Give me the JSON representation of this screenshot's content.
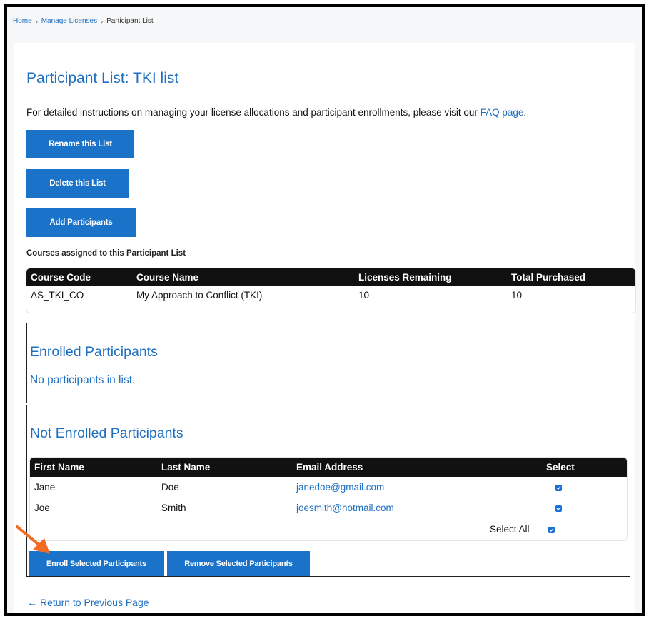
{
  "breadcrumb": {
    "home": "Home",
    "manage": "Manage Licenses",
    "current": "Participant List",
    "separator": "›"
  },
  "page": {
    "title": "Participant List: TKI list",
    "intro_text": "For detailed instructions on managing your license allocations and participant enrollments, please visit our ",
    "intro_link": "FAQ page",
    "intro_end": "."
  },
  "actions": {
    "rename": "Rename this List",
    "delete": "Delete this List",
    "add": "Add Participants"
  },
  "courses": {
    "label": "Courses assigned to this Participant List",
    "headers": [
      "Course Code",
      "Course Name",
      "Licenses Remaining",
      "Total Purchased"
    ],
    "rows": [
      [
        "AS_TKI_CO",
        "My Approach to Conflict (TKI)",
        "10",
        "10"
      ]
    ]
  },
  "enrolled": {
    "title": "Enrolled Participants",
    "empty": "No participants in list."
  },
  "not_enrolled": {
    "title": "Not Enrolled Participants",
    "headers": [
      "First Name",
      "Last Name",
      "Email Address",
      "Select"
    ],
    "rows": [
      {
        "first": "Jane",
        "last": "Doe",
        "email": "janedoe@gmail.com",
        "selected": true
      },
      {
        "first": "Joe",
        "last": "Smith",
        "email": "joesmith@hotmail.com",
        "selected": true
      }
    ],
    "select_all": "Select All",
    "enroll_button": "Enroll Selected Participants",
    "remove_button": "Remove Selected Participants"
  },
  "footer": {
    "return_arrow": "←",
    "return_text": "Return to Previous Page"
  },
  "colors": {
    "accent": "#1f6fbf",
    "button": "#1a73c9",
    "header_bg": "#111111",
    "annotation_arrow": "#f26b24"
  },
  "icons": {
    "checkbox": "checked-checkbox-icon",
    "annotation": "orange-arrow-icon"
  }
}
